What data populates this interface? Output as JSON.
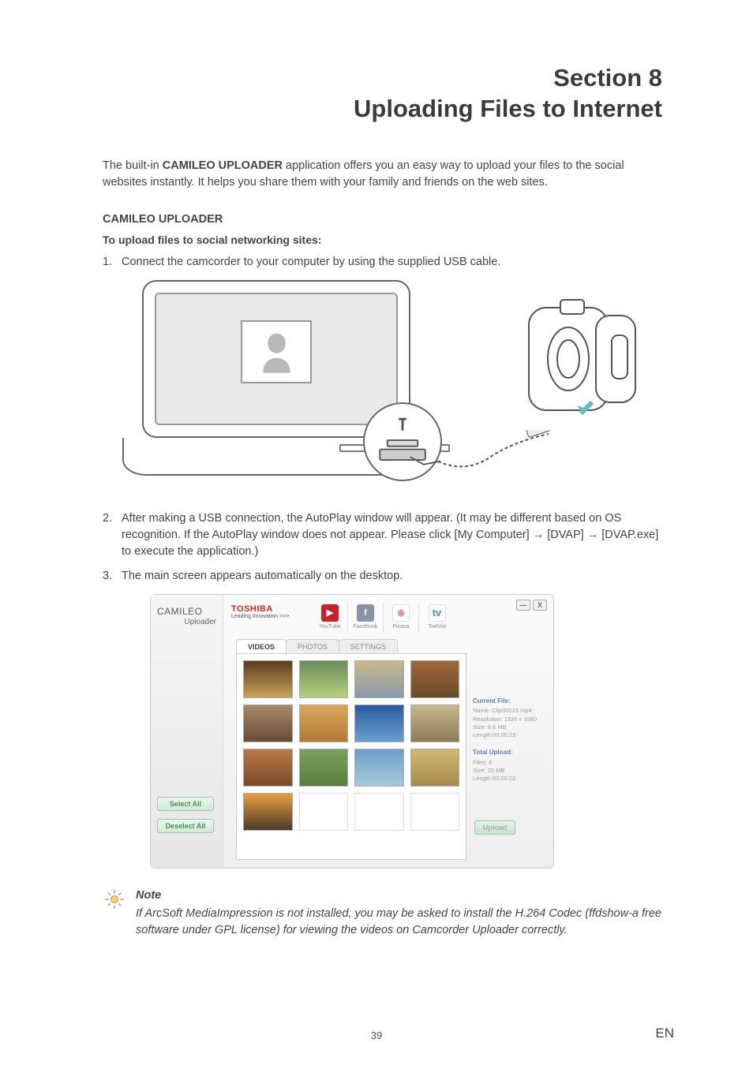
{
  "header": {
    "section_label": "Section 8",
    "section_title": "Uploading Files to Internet"
  },
  "intro": {
    "prefix": "The built-in ",
    "appname": "CAMILEO UPLOADER",
    "suffix": " application offers you an easy way to upload your files to the social websites instantly. It helps you share them with your family and friends on the web sites."
  },
  "headings": {
    "uploader": "CAMILEO UPLOADER",
    "howto": "To upload files to social networking sites:"
  },
  "steps": {
    "s1_num": "1.",
    "s1": "Connect the camcorder to your computer by using the supplied USB cable.",
    "s2_num": "2.",
    "s2": "After making a USB connection, the AutoPlay window will appear. (It may be different based on OS recognition. If the AutoPlay window does not appear. Please click [My Computer] → [DVAP] → [DVAP.exe] to execute the application.)",
    "s3_num": "3.",
    "s3": "The main screen appears automatically on the desktop."
  },
  "uploader": {
    "brand": {
      "l1": "CAMILEO",
      "l2": "Uploader"
    },
    "toshiba": {
      "l1": "TOSHIBA",
      "l2": "Leading Innovation >>>"
    },
    "social": [
      {
        "label": "YouTube",
        "bg": "#cc2127",
        "glyph": "▶"
      },
      {
        "label": "Facebook",
        "bg": "#8993a5",
        "glyph": "f"
      },
      {
        "label": "Picasa",
        "bg": "#ffffff",
        "glyph": "◉"
      },
      {
        "label": "TwitVid",
        "bg": "#ffffff",
        "glyph": "tv"
      }
    ],
    "tabs": [
      "VIDEOS",
      "PHOTOS",
      "SETTINGS"
    ],
    "select_all": "Select All",
    "deselect_all": "Deselect All",
    "current_file": {
      "hd": "Current File:",
      "name": "Name: Clip00015.mp4",
      "res": "Resolution: 1920 x 1080",
      "size": "Size: 6.6 MB",
      "len": "Length:00:00:23"
    },
    "total_upload": {
      "hd": "Total Upload:",
      "files": "Files: 4",
      "size": "Size: 26 MB",
      "len": "Length:00:00:23"
    },
    "upload_btn": "Upload",
    "win": {
      "min": "—",
      "close": "X"
    }
  },
  "note": {
    "hd": "Note",
    "body": "If ArcSoft MediaImpression is not installed, you may be asked to install the H.264 Codec (ffdshow-a free software under GPL license) for viewing the videos on Camcorder Uploader correctly."
  },
  "footer": {
    "page": "39",
    "lang": "EN"
  }
}
